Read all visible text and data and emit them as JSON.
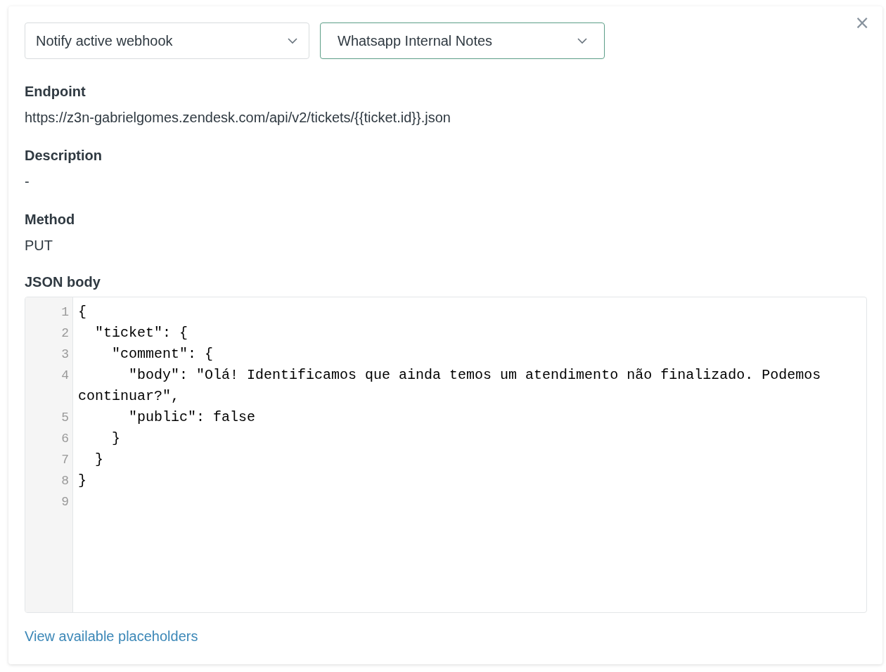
{
  "selects": [
    {
      "value": "Notify active webhook",
      "focused": false
    },
    {
      "value": "Whatsapp Internal Notes",
      "focused": true
    }
  ],
  "close_button": "×",
  "fields": [
    {
      "label": "Endpoint",
      "value": "https://z3n-gabrielgomes.zendesk.com/api/v2/tickets/{{ticket.id}}.json"
    },
    {
      "label": "Description",
      "value": "-"
    },
    {
      "label": "Method",
      "value": "PUT"
    }
  ],
  "json_body": {
    "label": "JSON body",
    "lines": [
      {
        "number": "1",
        "code": "{"
      },
      {
        "number": "2",
        "code": "  \"ticket\": {"
      },
      {
        "number": "3",
        "code": "    \"comment\": {"
      },
      {
        "number": "4",
        "code": "      \"body\": \"Olá! Identificamos que ainda temos um atendimento não finalizado. Podemos continuar?\","
      },
      {
        "number": "5",
        "code": "      \"public\": false"
      },
      {
        "number": "6",
        "code": "    }"
      },
      {
        "number": "7",
        "code": "  }"
      },
      {
        "number": "8",
        "code": "}"
      },
      {
        "number": "9"
      }
    ]
  },
  "link": "View available placeholders"
}
